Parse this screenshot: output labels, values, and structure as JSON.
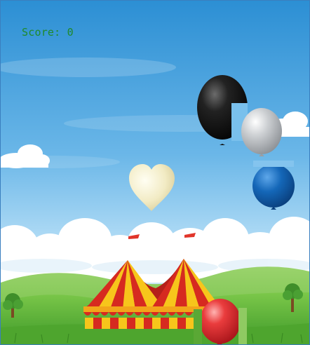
{
  "score": {
    "label": "Score:",
    "value": "0"
  },
  "balloons": [
    {
      "id": "black",
      "color": "#111111",
      "shape": "round"
    },
    {
      "id": "silver",
      "color": "#b9bcbf",
      "shape": "round"
    },
    {
      "id": "cream",
      "color": "#f3edc9",
      "shape": "heart"
    },
    {
      "id": "blue",
      "color": "#0f5fae",
      "shape": "round"
    },
    {
      "id": "red",
      "color": "#e2282c",
      "shape": "round"
    }
  ],
  "colors": {
    "sky_top": "#2f92d6",
    "sky_bottom": "#cbe8fa",
    "grass": "#68b93a",
    "score_text": "#1f8a2a",
    "tent_red": "#d62a20",
    "tent_yellow": "#f7c51b"
  }
}
